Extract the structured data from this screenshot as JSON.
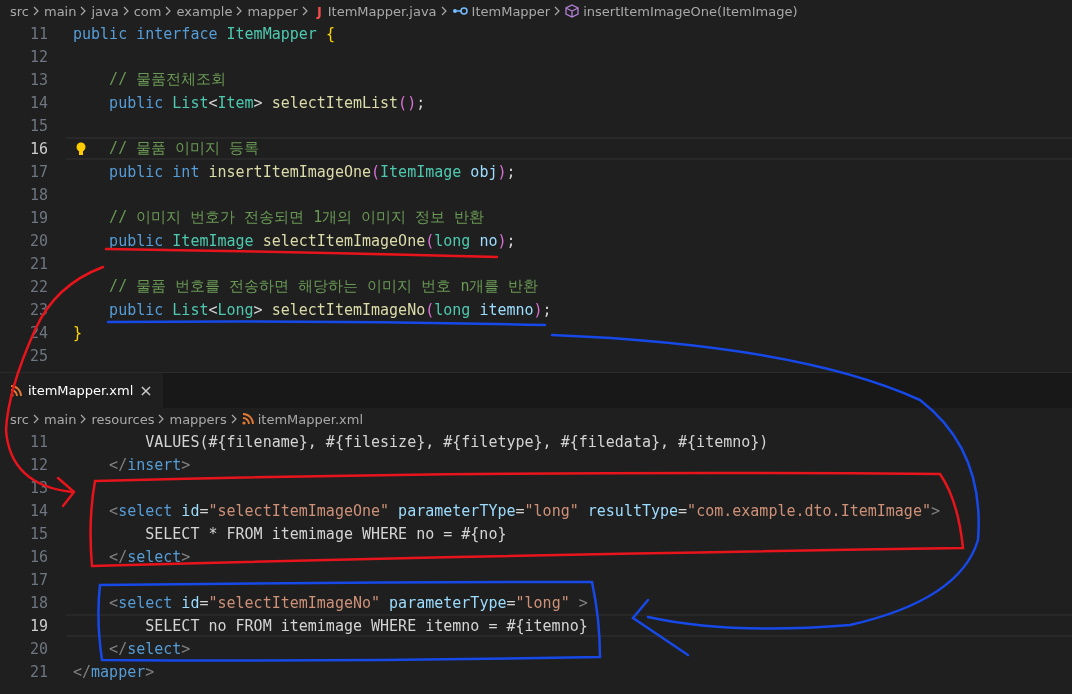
{
  "top_editor": {
    "breadcrumb": [
      {
        "label": "src",
        "kind": "folder"
      },
      {
        "label": "main",
        "kind": "folder"
      },
      {
        "label": "java",
        "kind": "folder"
      },
      {
        "label": "com",
        "kind": "folder"
      },
      {
        "label": "example",
        "kind": "folder"
      },
      {
        "label": "mapper",
        "kind": "folder"
      },
      {
        "label": "ItemMapper.java",
        "kind": "java-file",
        "badge": "J"
      },
      {
        "label": "ItemMapper",
        "kind": "interface"
      },
      {
        "label": "insertItemImageOne(ItemImage)",
        "kind": "method"
      }
    ],
    "lines": [
      {
        "n": "11",
        "current": false,
        "lightbulb": false,
        "tokens": [
          {
            "text": "public interface ",
            "kind": "keyword"
          },
          {
            "text": "ItemMapper ",
            "kind": "type"
          },
          {
            "text": "{",
            "kind": "brace"
          }
        ]
      },
      {
        "n": "12",
        "current": false,
        "lightbulb": false
      },
      {
        "n": "13",
        "current": false,
        "lightbulb": false,
        "tokens": [
          {
            "text": "    // 물품전체조회",
            "kind": "comment"
          }
        ]
      },
      {
        "n": "14",
        "current": false,
        "lightbulb": false,
        "tokens": [
          {
            "text": "    public ",
            "kind": "keyword"
          },
          {
            "text": "List",
            "kind": "type"
          },
          {
            "text": "<",
            "kind": "plain"
          },
          {
            "text": "Item",
            "kind": "type"
          },
          {
            "text": "> ",
            "kind": "plain"
          },
          {
            "text": "selectItemList",
            "kind": "method"
          },
          {
            "text": "()",
            "kind": "bracket"
          },
          {
            "text": ";",
            "kind": "plain"
          }
        ]
      },
      {
        "n": "15",
        "current": false,
        "lightbulb": false
      },
      {
        "n": "16",
        "current": true,
        "lightbulb": true,
        "tokens": [
          {
            "text": "    // 물품 이미지 등록",
            "kind": "comment"
          }
        ]
      },
      {
        "n": "17",
        "current": false,
        "lightbulb": false,
        "tokens": [
          {
            "text": "    public int ",
            "kind": "keyword"
          },
          {
            "text": "insertItemImageOne",
            "kind": "method"
          },
          {
            "text": "(",
            "kind": "bracket"
          },
          {
            "text": "ItemImage ",
            "kind": "type"
          },
          {
            "text": "obj",
            "kind": "param"
          },
          {
            "text": ")",
            "kind": "bracket"
          },
          {
            "text": ";",
            "kind": "plain"
          }
        ]
      },
      {
        "n": "18",
        "current": false,
        "lightbulb": false
      },
      {
        "n": "19",
        "current": false,
        "lightbulb": false,
        "tokens": [
          {
            "text": "    // 이미지 번호가 전송되면 1개의 이미지 정보 반환",
            "kind": "comment"
          }
        ]
      },
      {
        "n": "20",
        "current": false,
        "lightbulb": false,
        "tokens": [
          {
            "text": "    public ",
            "kind": "keyword"
          },
          {
            "text": "ItemImage ",
            "kind": "type"
          },
          {
            "text": "selectItemImageOne",
            "kind": "method"
          },
          {
            "text": "(",
            "kind": "bracket"
          },
          {
            "text": "long ",
            "kind": "type"
          },
          {
            "text": "no",
            "kind": "param"
          },
          {
            "text": ")",
            "kind": "bracket"
          },
          {
            "text": ";",
            "kind": "plain"
          }
        ]
      },
      {
        "n": "21",
        "current": false,
        "lightbulb": false
      },
      {
        "n": "22",
        "current": false,
        "lightbulb": false,
        "tokens": [
          {
            "text": "    // 물품 번호를 전송하면 해당하는 이미지 번호 n개를 반환",
            "kind": "comment"
          }
        ]
      },
      {
        "n": "23",
        "current": false,
        "lightbulb": false,
        "tokens": [
          {
            "text": "    public ",
            "kind": "keyword"
          },
          {
            "text": "List",
            "kind": "type"
          },
          {
            "text": "<",
            "kind": "plain"
          },
          {
            "text": "Long",
            "kind": "type"
          },
          {
            "text": "> ",
            "kind": "plain"
          },
          {
            "text": "selectItemImageNo",
            "kind": "method"
          },
          {
            "text": "(",
            "kind": "bracket"
          },
          {
            "text": "long ",
            "kind": "type"
          },
          {
            "text": "itemno",
            "kind": "param"
          },
          {
            "text": ")",
            "kind": "bracket"
          },
          {
            "text": ";",
            "kind": "plain"
          }
        ]
      },
      {
        "n": "24",
        "current": false,
        "lightbulb": false,
        "tokens": [
          {
            "text": "}",
            "kind": "brace"
          }
        ]
      },
      {
        "n": "25",
        "current": false,
        "lightbulb": false
      }
    ]
  },
  "tabs": [
    {
      "label": "itemMapper.xml",
      "kind": "xml-file",
      "close": "×",
      "selected": true
    }
  ],
  "bottom_editor": {
    "breadcrumb": [
      {
        "label": "src",
        "kind": "folder"
      },
      {
        "label": "main",
        "kind": "folder"
      },
      {
        "label": "resources",
        "kind": "folder"
      },
      {
        "label": "mappers",
        "kind": "folder"
      },
      {
        "label": "itemMapper.xml",
        "kind": "xml-file"
      }
    ],
    "lines": [
      {
        "n": "11",
        "current": false,
        "lightbulb": false,
        "tokens": [
          {
            "text": "        VALUES(#{filename}, #{filesize}, #{filetype}, #{filedata}, #{itemno})",
            "kind": "plain"
          }
        ]
      },
      {
        "n": "12",
        "current": false,
        "lightbulb": false,
        "tokens": [
          {
            "text": "    </",
            "kind": "punct"
          },
          {
            "text": "insert",
            "kind": "tag"
          },
          {
            "text": ">",
            "kind": "punct"
          }
        ]
      },
      {
        "n": "13",
        "current": false,
        "lightbulb": false
      },
      {
        "n": "14",
        "current": false,
        "lightbulb": false,
        "tokens": [
          {
            "text": "    <",
            "kind": "punct"
          },
          {
            "text": "select ",
            "kind": "tag"
          },
          {
            "text": "id",
            "kind": "attr"
          },
          {
            "text": "=",
            "kind": "plain"
          },
          {
            "text": "\"selectItemImageOne\" ",
            "kind": "string"
          },
          {
            "text": "parameterTYpe",
            "kind": "attr"
          },
          {
            "text": "=",
            "kind": "plain"
          },
          {
            "text": "\"long\" ",
            "kind": "string"
          },
          {
            "text": "resultType",
            "kind": "attr"
          },
          {
            "text": "=",
            "kind": "plain"
          },
          {
            "text": "\"com.example.dto.ItemImage\"",
            "kind": "string"
          },
          {
            "text": ">",
            "kind": "punct"
          }
        ]
      },
      {
        "n": "15",
        "current": false,
        "lightbulb": false,
        "tokens": [
          {
            "text": "        SELECT * FROM itemimage WHERE no = #{no}",
            "kind": "plain"
          }
        ]
      },
      {
        "n": "16",
        "current": false,
        "lightbulb": false,
        "tokens": [
          {
            "text": "    </",
            "kind": "punct"
          },
          {
            "text": "select",
            "kind": "tag"
          },
          {
            "text": ">",
            "kind": "punct"
          }
        ]
      },
      {
        "n": "17",
        "current": false,
        "lightbulb": false
      },
      {
        "n": "18",
        "current": false,
        "lightbulb": false,
        "tokens": [
          {
            "text": "    <",
            "kind": "punct"
          },
          {
            "text": "select ",
            "kind": "tag"
          },
          {
            "text": "id",
            "kind": "attr"
          },
          {
            "text": "=",
            "kind": "plain"
          },
          {
            "text": "\"selectItemImageNo\" ",
            "kind": "string"
          },
          {
            "text": "parameterType",
            "kind": "attr"
          },
          {
            "text": "=",
            "kind": "plain"
          },
          {
            "text": "\"long\" ",
            "kind": "string"
          },
          {
            "text": ">",
            "kind": "punct"
          }
        ]
      },
      {
        "n": "19",
        "current": true,
        "lightbulb": false,
        "tokens": [
          {
            "text": "        SELECT no FROM itemimage WHERE itemno = #{itemno}",
            "kind": "plain"
          }
        ]
      },
      {
        "n": "20",
        "current": false,
        "lightbulb": false,
        "tokens": [
          {
            "text": "    </",
            "kind": "punct"
          },
          {
            "text": "select",
            "kind": "tag"
          },
          {
            "text": ">",
            "kind": "punct"
          }
        ]
      },
      {
        "n": "21",
        "current": false,
        "lightbulb": false,
        "tokens": [
          {
            "text": "</",
            "kind": "punct"
          },
          {
            "text": "mapper",
            "kind": "tag"
          },
          {
            "text": ">",
            "kind": "punct"
          }
        ]
      }
    ]
  }
}
